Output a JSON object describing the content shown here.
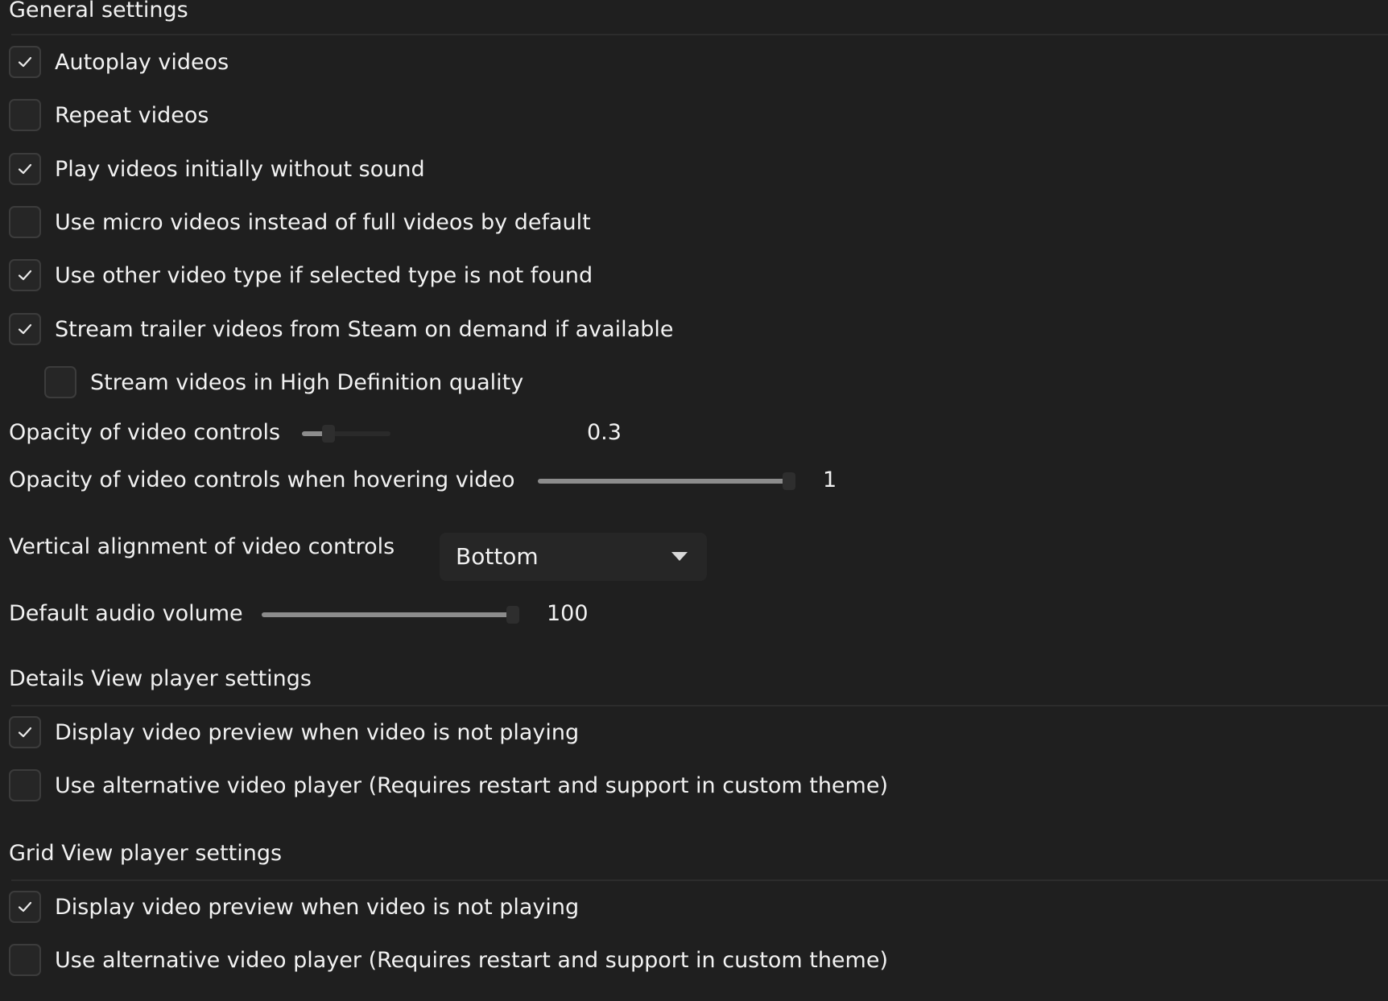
{
  "general": {
    "title": "General settings",
    "checkboxes": [
      {
        "label": "Autoplay videos",
        "checked": true
      },
      {
        "label": "Repeat videos",
        "checked": false
      },
      {
        "label": "Play videos initially without sound",
        "checked": true
      },
      {
        "label": "Use micro videos instead of full videos by default",
        "checked": false
      },
      {
        "label": "Use other video type if selected type is not found",
        "checked": true
      },
      {
        "label": "Stream trailer videos from Steam on demand if available",
        "checked": true
      },
      {
        "label": "Stream videos in High Definition quality",
        "checked": false
      }
    ],
    "opacity": {
      "label": "Opacity of video controls",
      "value": "0.3",
      "fraction": 0.3
    },
    "opacity_hover": {
      "label": "Opacity of video controls when hovering video",
      "value": "1",
      "fraction": 1
    },
    "alignment": {
      "label": "Vertical alignment of video controls",
      "selected": "Bottom"
    },
    "volume": {
      "label": "Default audio volume",
      "value": "100",
      "fraction": 1
    }
  },
  "details": {
    "title": "Details View player settings",
    "checkboxes": [
      {
        "label": "Display video preview when video is not playing",
        "checked": true
      },
      {
        "label": "Use alternative video player (Requires restart and support in custom theme)",
        "checked": false
      }
    ]
  },
  "grid": {
    "title": "Grid View player settings",
    "checkboxes": [
      {
        "label": "Display video preview when video is not playing",
        "checked": true
      },
      {
        "label": "Use alternative video player (Requires restart and support in custom theme)",
        "checked": false
      }
    ]
  },
  "icons": {
    "check": "checkmark-icon",
    "dropdown": "chevron-down-icon"
  },
  "colors": {
    "background": "#1f1f1f",
    "text": "#f2f2f2",
    "slider_fill": "#8c8c8c"
  }
}
